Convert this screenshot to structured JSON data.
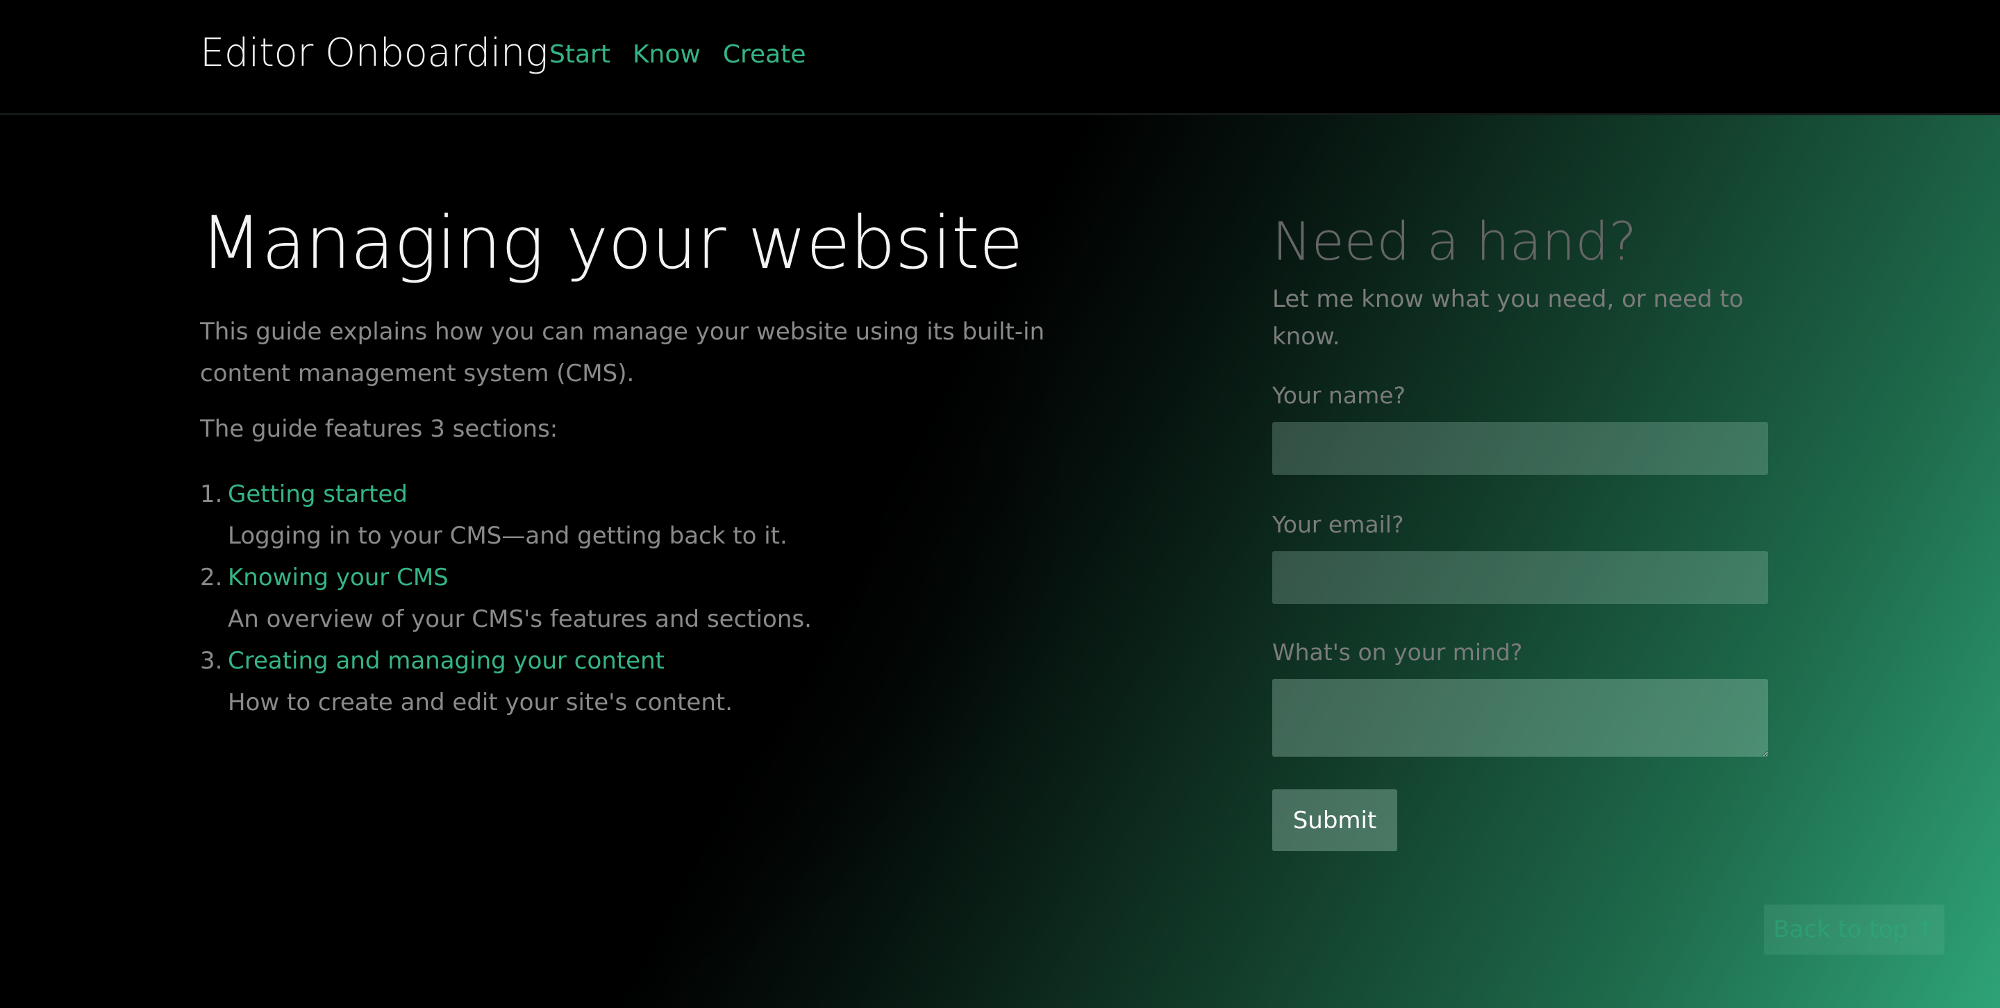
{
  "header": {
    "brand": "Editor Onboarding",
    "nav": [
      {
        "label": "Start"
      },
      {
        "label": "Know"
      },
      {
        "label": "Create"
      }
    ]
  },
  "main": {
    "title": "Managing your website",
    "intro": "This guide explains how you can manage your website using its built-in content management system (CMS).",
    "sections_note": "The guide features 3 sections:",
    "sections": [
      {
        "number": "1.",
        "label": "Getting started",
        "description": "Logging in to your CMS—and getting back to it."
      },
      {
        "number": "2.",
        "label": "Knowing your CMS",
        "description": "An overview of your CMS's features and sections."
      },
      {
        "number": "3.",
        "label": "Creating and managing your content",
        "description": "How to create and edit your site's content."
      }
    ]
  },
  "help_form": {
    "title": "Need a hand?",
    "subtitle": "Let me know what you need, or need to know.",
    "name_label": "Your name?",
    "name_value": "",
    "email_label": "Your email?",
    "email_value": "",
    "message_label": "What's on your mind?",
    "message_value": "",
    "submit_label": "Submit"
  },
  "back_to_top": {
    "label": "Back to top ↑"
  },
  "colors": {
    "accent": "#35b585",
    "background": "#000000",
    "gradient_end": "#2fa378"
  }
}
